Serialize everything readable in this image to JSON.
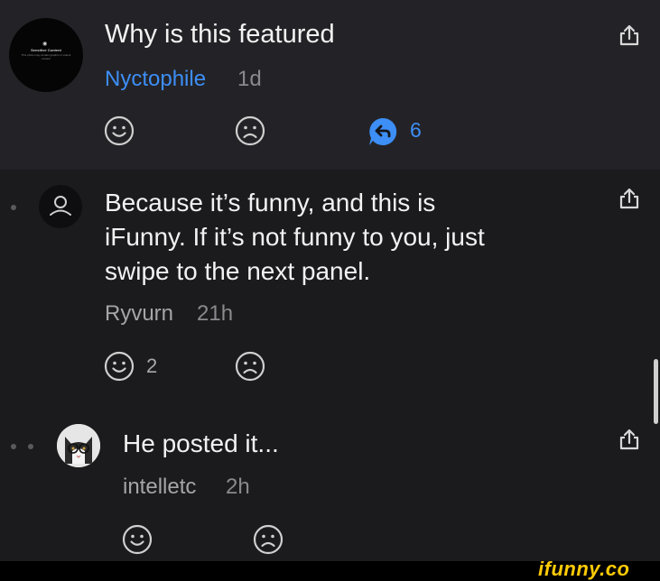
{
  "post": {
    "title": "Why is this featured",
    "author": "Nyctophile",
    "time": "1d",
    "reply_count": "6",
    "avatar_overlay": {
      "heading": "Sensitive Content",
      "body": "This photo may contain graphic or violent content"
    }
  },
  "replies": [
    {
      "text_lines": [
        "Because it’s funny, and this is",
        "iFunny. If it’s not funny to you, just",
        "swipe to the next panel."
      ],
      "author": "Ryvurn",
      "time": "21h",
      "like_count": "2"
    },
    {
      "text_lines": [
        "He posted it..."
      ],
      "author": "intelletc",
      "time": "2h"
    }
  ],
  "watermark": "ifunny.co",
  "colors": {
    "accent": "#3d8ef5",
    "background": "#1b1b1e",
    "header_background": "#232327",
    "watermark": "#ffcb05"
  },
  "icons": [
    "share-icon",
    "smile-icon",
    "frown-icon",
    "reply-icon",
    "user-icon"
  ]
}
